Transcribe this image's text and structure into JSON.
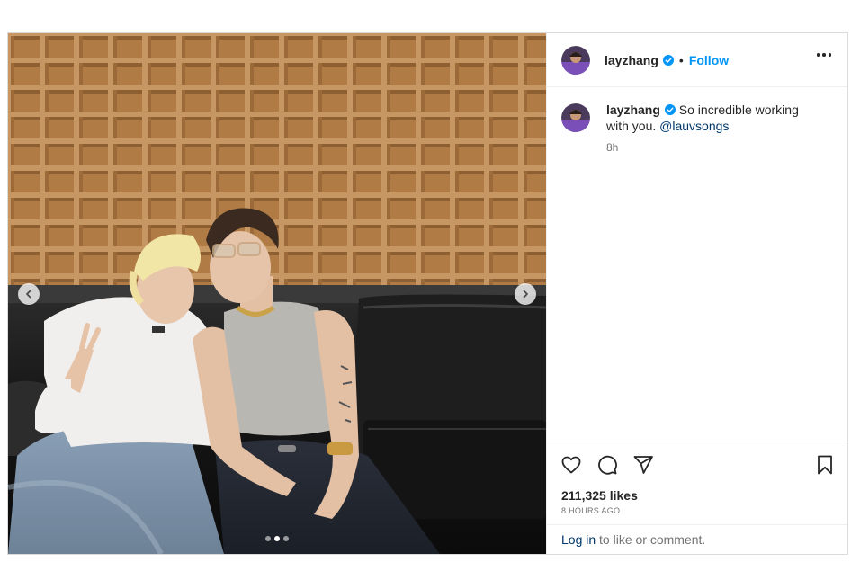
{
  "post": {
    "username": "layzhang",
    "follow_label": "Follow",
    "separator": "•",
    "caption_text": "So incredible working with you.",
    "caption_mention": "@lauvsongs",
    "time_ago": "8h",
    "likes": "211,325 likes",
    "date_label": "8 HOURS AGO",
    "login_link": "Log in",
    "login_suffix": "to like or comment.",
    "carousel": {
      "total": 3,
      "current": 2
    }
  },
  "icons": {
    "verified": "verified-badge-icon",
    "more": "more-options-icon",
    "like": "heart-icon",
    "comment": "comment-icon",
    "share": "paper-plane-icon",
    "save": "bookmark-icon",
    "prev": "chevron-left-icon",
    "next": "chevron-right-icon"
  },
  "colors": {
    "accent": "#0095f6",
    "link": "#00376b",
    "muted": "#737373",
    "border": "#dbdbdb"
  }
}
